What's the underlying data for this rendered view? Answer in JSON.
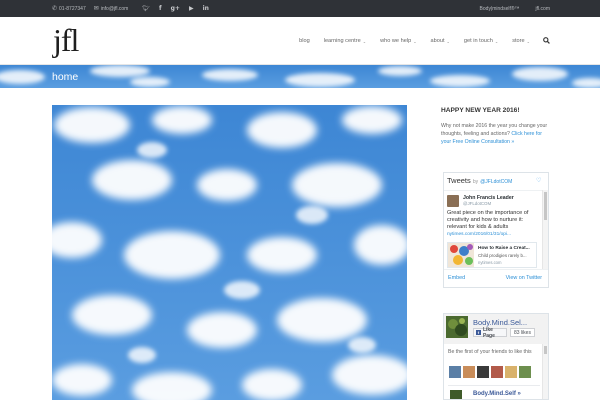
{
  "topbar": {
    "phone_icon": "phone-icon",
    "phone": "01-8727347",
    "email_icon": "envelope-icon",
    "email": "info@jfl.com",
    "social": [
      "twitter-icon",
      "facebook-icon",
      "google-plus-icon",
      "youtube-icon",
      "linkedin-icon"
    ],
    "right_links": [
      "Body|mindself®™",
      "jfl.com"
    ]
  },
  "header": {
    "logo": "jfl",
    "nav": [
      {
        "label": "blog",
        "dropdown": false
      },
      {
        "label": "learning centre",
        "dropdown": true
      },
      {
        "label": "who we help",
        "dropdown": true
      },
      {
        "label": "about",
        "dropdown": true
      },
      {
        "label": "get in touch",
        "dropdown": true
      },
      {
        "label": "store",
        "dropdown": true
      }
    ],
    "search_icon": "search-icon"
  },
  "banner": {
    "title": "home"
  },
  "sidebar": {
    "title": "HAPPY NEW YEAR 2016!",
    "text": "Why not make 2016 the year you change your thoughts, feeling and actions? ",
    "link": "Click here for your Free Online Consultation »"
  },
  "twitter": {
    "heading": "Tweets",
    "by": "by",
    "handle": "@JFLdotCOM",
    "tweet": {
      "name": "John Francis Leader",
      "user": "@JFLdotCOM",
      "text": "Great piece on the importance of creativity and how to nurture it: relevant for kids & adults",
      "url": "nytimes.com/2016/01/31/opi...",
      "card_title": "How to Raise a Creat...",
      "card_desc": "Child prodigies rarely b...",
      "card_site": "nytimes.com"
    },
    "embed": "Embed",
    "view": "View on Twitter"
  },
  "facebook": {
    "page_name": "Body.Mind.Sel...",
    "like_label": "Like Page",
    "likes": "83 likes",
    "friends_text": "Be the first of your friends to like this",
    "post_title": "Body.Mind.Self »"
  },
  "colors": {
    "topbar_bg": "#2f3237",
    "sky": "#4a8fd8",
    "link": "#2b8fd6",
    "fb_blue": "#3b5998"
  }
}
